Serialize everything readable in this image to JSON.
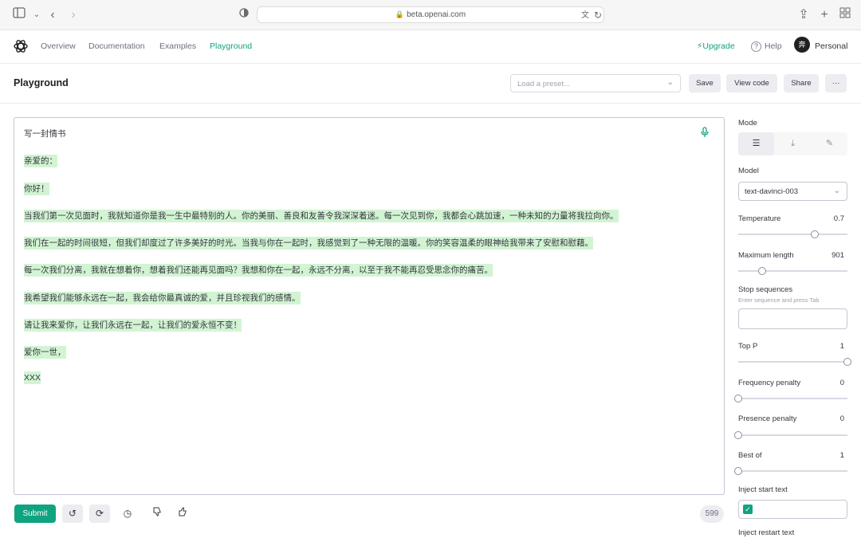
{
  "browser": {
    "url": "beta.openai.com"
  },
  "nav": {
    "items": [
      "Overview",
      "Documentation",
      "Examples",
      "Playground"
    ],
    "active": "Playground",
    "upgrade": "Upgrade",
    "help": "Help",
    "avatar_initial": "奔",
    "account": "Personal"
  },
  "toolbar": {
    "title": "Playground",
    "preset_placeholder": "Load a preset...",
    "save": "Save",
    "view_code": "View code",
    "share": "Share",
    "more": "···"
  },
  "editor": {
    "prompt": "写一封情书",
    "lines": [
      "亲爱的：",
      "你好！",
      "当我们第一次见面时，我就知道你是我一生中最特别的人。你的美丽、善良和友善令我深深着迷。每一次见到你，我都会心跳加速，一种未知的力量将我拉向你。",
      "我们在一起的时间很短，但我们却度过了许多美好的时光。当我与你在一起时，我感觉到了一种无限的温暖。你的笑容温柔的眼神给我带来了安慰和慰藉。",
      "每一次我们分离，我就在想着你，想着我们还能再见面吗？我想和你在一起，永远不分离，以至于我不能再忍受思念你的痛苦。",
      "我希望我们能够永远在一起，我会给你最真诚的爱，并且珍视我们的感情。",
      "请让我来爱你，让我们永远在一起，让我们的爱永恒不变！",
      "爱你一世，",
      "XXX"
    ]
  },
  "bottom": {
    "submit": "Submit",
    "token_count": "599"
  },
  "settings": {
    "mode_label": "Mode",
    "model_label": "Model",
    "model_value": "text-davinci-003",
    "temperature": {
      "label": "Temperature",
      "value": "0.7",
      "level": 0.7
    },
    "max_length": {
      "label": "Maximum length",
      "value": "901",
      "level": 0.22
    },
    "stop_sequences": {
      "label": "Stop sequences",
      "hint": "Enter sequence and press Tab"
    },
    "top_p": {
      "label": "Top P",
      "value": "1",
      "level": 1.0
    },
    "frequency_penalty": {
      "label": "Frequency penalty",
      "value": "0",
      "level": 0.0
    },
    "presence_penalty": {
      "label": "Presence penalty",
      "value": "0",
      "level": 0.0
    },
    "best_of": {
      "label": "Best of",
      "value": "1",
      "level": 0.0
    },
    "inject_start": {
      "label": "Inject start text",
      "checked": true
    },
    "inject_restart": {
      "label": "Inject restart text"
    }
  }
}
